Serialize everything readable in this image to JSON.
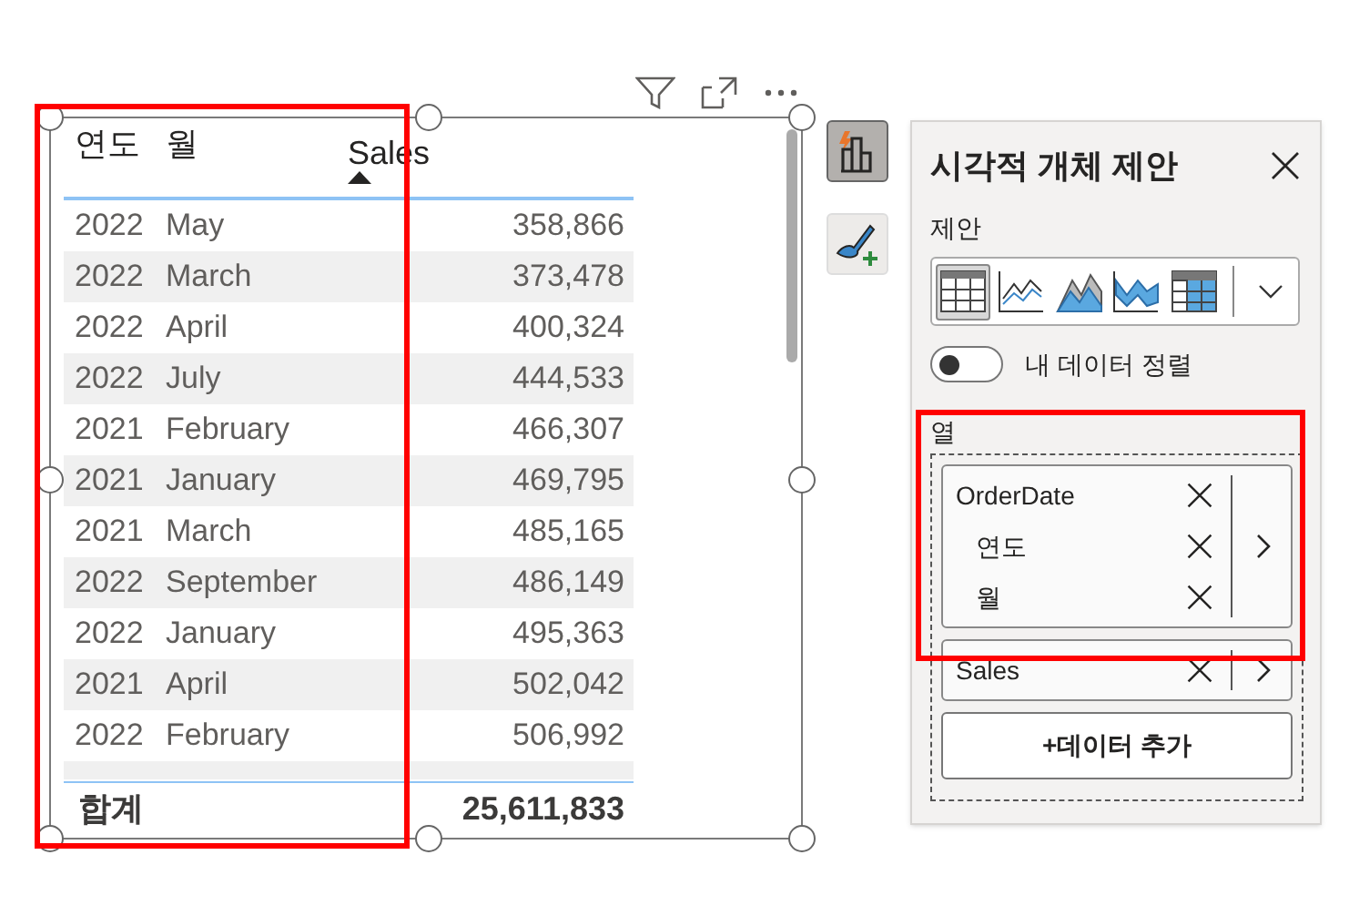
{
  "table": {
    "columns": [
      {
        "label": "연도",
        "sort_ascending": false
      },
      {
        "label": "월",
        "sort_ascending": false
      },
      {
        "label": "Sales",
        "sort_ascending": true
      }
    ],
    "rows": [
      {
        "cells": [
          "2022",
          "May",
          "358,866"
        ]
      },
      {
        "cells": [
          "2022",
          "March",
          "373,478"
        ]
      },
      {
        "cells": [
          "2022",
          "April",
          "400,324"
        ]
      },
      {
        "cells": [
          "2022",
          "July",
          "444,533"
        ]
      },
      {
        "cells": [
          "2021",
          "February",
          "466,307"
        ]
      },
      {
        "cells": [
          "2021",
          "January",
          "469,795"
        ]
      },
      {
        "cells": [
          "2021",
          "March",
          "485,165"
        ]
      },
      {
        "cells": [
          "2022",
          "September",
          "486,149"
        ]
      },
      {
        "cells": [
          "2022",
          "January",
          "495,363"
        ]
      },
      {
        "cells": [
          "2021",
          "April",
          "502,042"
        ]
      },
      {
        "cells": [
          "2022",
          "February",
          "506,992"
        ]
      }
    ],
    "total": {
      "label": "합계",
      "value": "25,611,833"
    }
  },
  "side_buttons": [
    {
      "kind": "suggest",
      "selected": true
    },
    {
      "kind": "format",
      "selected": false
    }
  ],
  "pane": {
    "title": "시각적 개체 제안",
    "suggestions_label": "제안",
    "suggestions": [
      {
        "kind": "table",
        "selected": true
      },
      {
        "kind": "line",
        "selected": false
      },
      {
        "kind": "area",
        "selected": false
      },
      {
        "kind": "stacked-area",
        "selected": false
      },
      {
        "kind": "matrix",
        "selected": false
      }
    ],
    "toggle": {
      "label": "내 데이터 정렬",
      "on": false
    },
    "well_label": "열",
    "fields": [
      {
        "name": "OrderDate",
        "children": [
          {
            "name": "연도"
          },
          {
            "name": "월"
          }
        ]
      },
      {
        "name": "Sales"
      }
    ],
    "add_button": "+데이터 추가"
  }
}
